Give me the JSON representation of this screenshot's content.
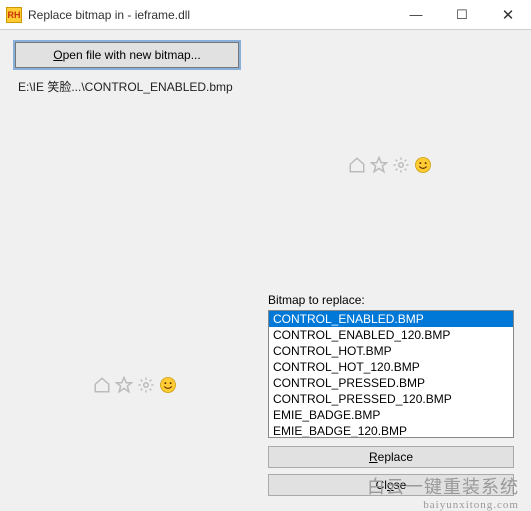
{
  "window": {
    "app_icon_text": "RH",
    "title": "Replace bitmap in - ieframe.dll",
    "minimize": "—",
    "maximize": "☐",
    "close": "✕"
  },
  "open_button_label": "Open file with new bitmap...",
  "opened_path": "E:\\IE 笑脸...\\CONTROL_ENABLED.bmp",
  "list_label": "Bitmap to replace:",
  "bitmaps": [
    "CONTROL_ENABLED.BMP",
    "CONTROL_ENABLED_120.BMP",
    "CONTROL_HOT.BMP",
    "CONTROL_HOT_120.BMP",
    "CONTROL_PRESSED.BMP",
    "CONTROL_PRESSED_120.BMP",
    "EMIE_BADGE.BMP",
    "EMIE_BADGE_120.BMP"
  ],
  "selected_index": 0,
  "replace_label": "Replace",
  "close_label": "Close",
  "watermark": "白云一键重装系统",
  "watermark_sub": "baiyunxitong.com",
  "icons": {
    "home": "home-icon",
    "star": "star-icon",
    "gear": "gear-icon",
    "smiley": "smiley-icon"
  }
}
